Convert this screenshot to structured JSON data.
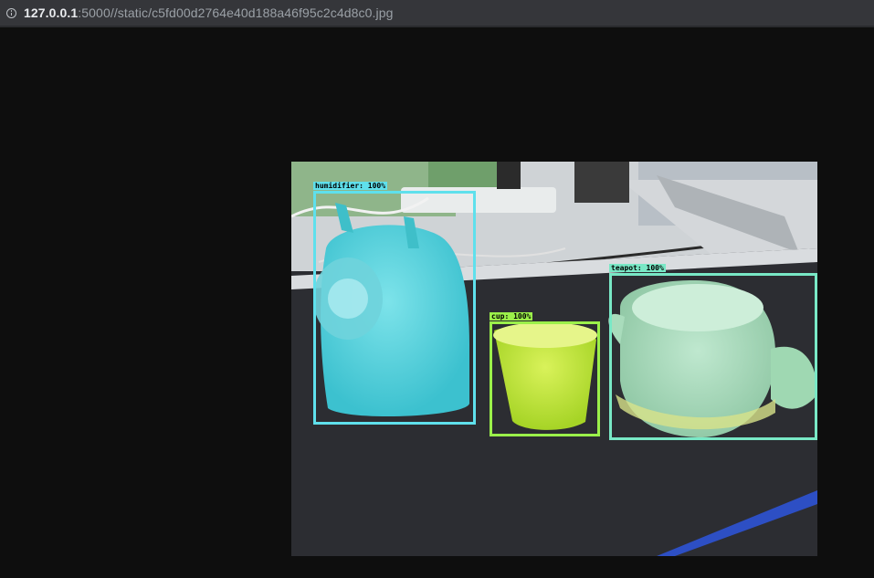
{
  "browser": {
    "url_host": "127.0.0.1",
    "url_rest": ":5000//static/c5fd00d2764e40d188a46f95c2c4d8c0.jpg",
    "info_icon": "info-icon"
  },
  "detections": [
    {
      "label": "humidifier: 100%",
      "color": "#5fe0ec"
    },
    {
      "label": "cup: 100%",
      "color": "#9bf04a"
    },
    {
      "label": "teapot: 100%",
      "color": "#79e8c6"
    }
  ]
}
